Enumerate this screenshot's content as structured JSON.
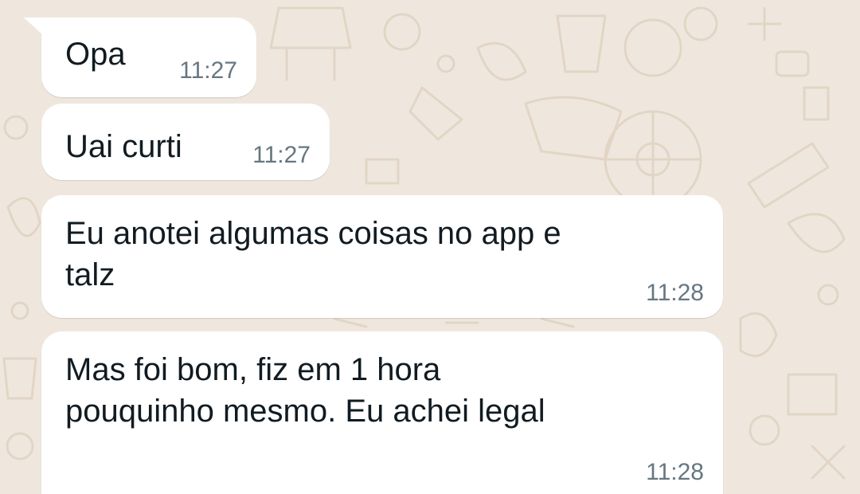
{
  "chat": {
    "messages": [
      {
        "text": "Opa",
        "time": "11:27"
      },
      {
        "text": "Uai curti",
        "time": "11:27"
      },
      {
        "lines": [
          "Eu anotei algumas coisas no app e",
          "talz"
        ],
        "time": "11:28"
      },
      {
        "lines": [
          "Mas foi bom, fiz em 1 hora",
          "pouquinho mesmo. Eu achei legal"
        ],
        "time": "11:28"
      }
    ]
  },
  "colors": {
    "wallpaper": "#efe7dd",
    "bubble": "#ffffff",
    "text": "#111b21",
    "timestamp": "#667781"
  }
}
